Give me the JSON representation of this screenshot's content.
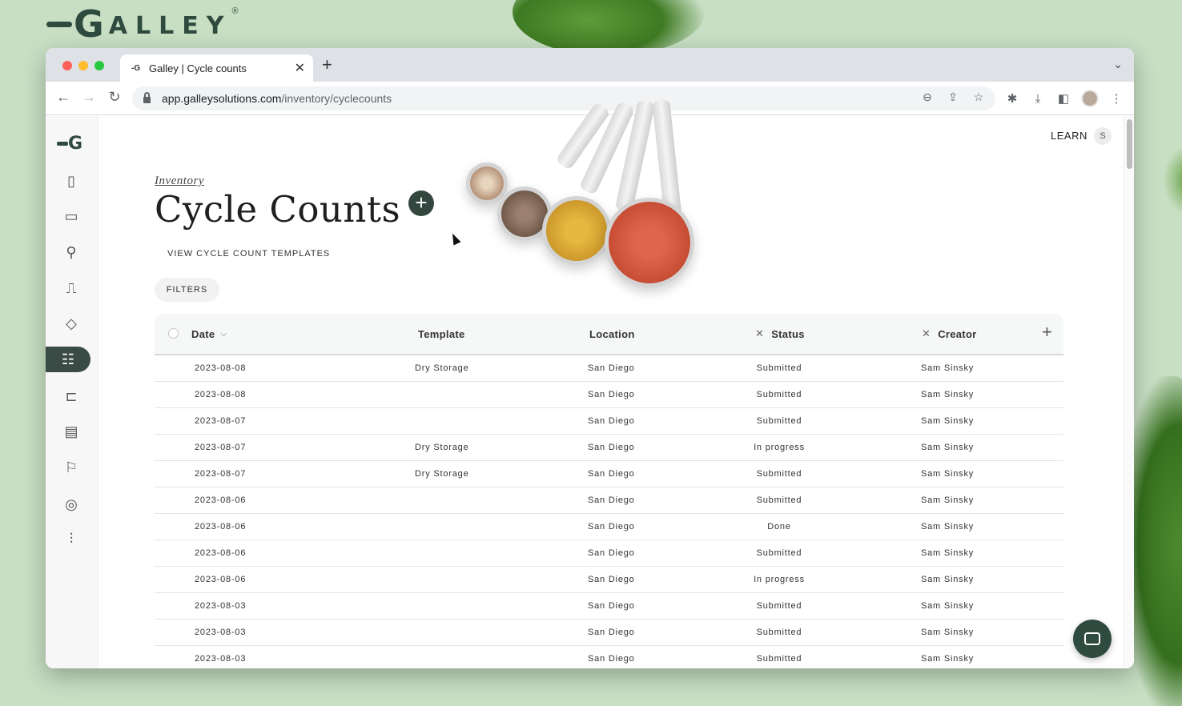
{
  "brand": {
    "first": "G",
    "rest": "ALLEY",
    "reg": "®"
  },
  "browser": {
    "tab_title": "Galley | Cycle counts",
    "tab_favicon": "-G",
    "url_host": "app.galleysolutions.com",
    "url_path": "/inventory/cyclecounts",
    "icons": {
      "back": "arrow-left-icon",
      "forward": "arrow-right-icon",
      "reload": "reload-icon",
      "zoom": "zoom-out-icon",
      "share": "share-icon",
      "bookmark": "star-icon",
      "extensions": "puzzle-icon",
      "download": "download-icon",
      "sidepanel": "side-panel-icon",
      "menu": "kebab-menu-icon"
    }
  },
  "sidebar": {
    "logo": "G",
    "items": [
      {
        "icon": "clipboard-icon"
      },
      {
        "icon": "book-icon"
      },
      {
        "icon": "ingredient-icon"
      },
      {
        "icon": "containers-icon"
      },
      {
        "icon": "tag-icon"
      },
      {
        "icon": "inventory-list-icon",
        "active": true
      },
      {
        "icon": "cart-icon"
      },
      {
        "icon": "document-icon"
      },
      {
        "icon": "location-pin-icon"
      },
      {
        "icon": "dining-icon"
      },
      {
        "icon": "sliders-icon"
      }
    ]
  },
  "header": {
    "learn": "LEARN",
    "user_initial": "S"
  },
  "page": {
    "breadcrumb": "Inventory",
    "title": "Cycle Counts",
    "add": "+",
    "templates_link": "VIEW CYCLE COUNT TEMPLATES",
    "filters": "FILTERS"
  },
  "table": {
    "columns": {
      "date": "Date",
      "template": "Template",
      "location": "Location",
      "status": "Status",
      "creator": "Creator"
    },
    "remove_glyph": "✕",
    "sort_glyph": "⌵",
    "add_column": "+",
    "rows": [
      {
        "date": "2023-08-08",
        "template": "Dry Storage",
        "location": "San Diego",
        "status": "Submitted",
        "creator": "Sam Sinsky"
      },
      {
        "date": "2023-08-08",
        "template": "",
        "location": "San Diego",
        "status": "Submitted",
        "creator": "Sam Sinsky"
      },
      {
        "date": "2023-08-07",
        "template": "",
        "location": "San Diego",
        "status": "Submitted",
        "creator": "Sam Sinsky"
      },
      {
        "date": "2023-08-07",
        "template": "Dry Storage",
        "location": "San Diego",
        "status": "In progress",
        "creator": "Sam Sinsky"
      },
      {
        "date": "2023-08-07",
        "template": "Dry Storage",
        "location": "San Diego",
        "status": "Submitted",
        "creator": "Sam Sinsky"
      },
      {
        "date": "2023-08-06",
        "template": "",
        "location": "San Diego",
        "status": "Submitted",
        "creator": "Sam Sinsky"
      },
      {
        "date": "2023-08-06",
        "template": "",
        "location": "San Diego",
        "status": "Done",
        "creator": "Sam Sinsky"
      },
      {
        "date": "2023-08-06",
        "template": "",
        "location": "San Diego",
        "status": "Submitted",
        "creator": "Sam Sinsky"
      },
      {
        "date": "2023-08-06",
        "template": "",
        "location": "San Diego",
        "status": "In progress",
        "creator": "Sam Sinsky"
      },
      {
        "date": "2023-08-03",
        "template": "",
        "location": "San Diego",
        "status": "Submitted",
        "creator": "Sam Sinsky"
      },
      {
        "date": "2023-08-03",
        "template": "",
        "location": "San Diego",
        "status": "Submitted",
        "creator": "Sam Sinsky"
      },
      {
        "date": "2023-08-03",
        "template": "",
        "location": "San Diego",
        "status": "Submitted",
        "creator": "Sam Sinsky"
      }
    ]
  },
  "colors": {
    "brand": "#2f4a3e",
    "sidebar_active": "#3a4a45"
  }
}
